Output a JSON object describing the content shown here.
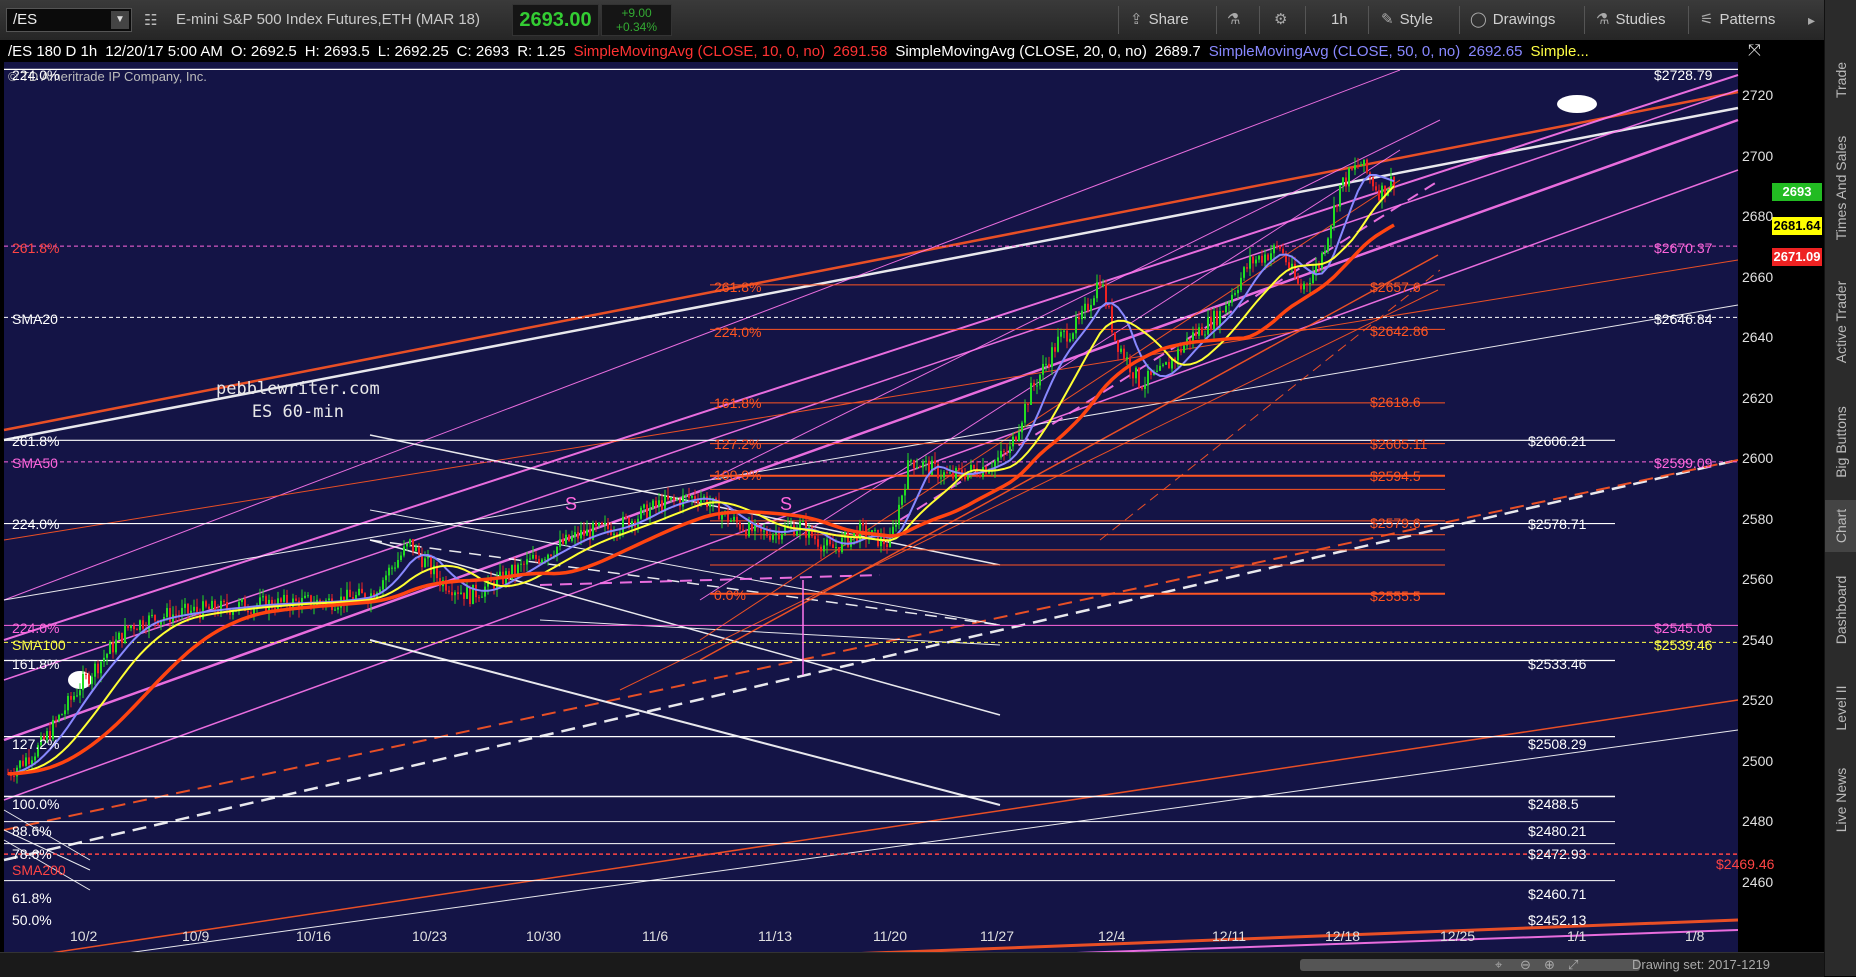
{
  "toolbar": {
    "symbol": "/ES",
    "description": "E-mini S&P 500 Index Futures,ETH (MAR 18)",
    "last_price": "2693.00",
    "change": "+9.00",
    "change_pct": "+0.34%",
    "buttons": {
      "share": "Share",
      "interval": "1h",
      "style": "Style",
      "drawings": "Drawings",
      "studies": "Studies",
      "patterns": "Patterns"
    },
    "colors": {
      "price_up": "#33cc33"
    }
  },
  "info_bar": {
    "symbol_period": "/ES 180 D 1h",
    "date": "12/20/17 5:00 AM",
    "open": "O: 2692.5",
    "high": "H: 2693.5",
    "low": "L: 2692.25",
    "close": "C: 2693",
    "range": "R: 1.25",
    "sma10_label": "SimpleMovingAvg (CLOSE, 10, 0, no)",
    "sma10_value": "2691.58",
    "sma20_label": "SimpleMovingAvg (CLOSE, 20, 0, no)",
    "sma20_value": "2689.7",
    "sma50_label": "SimpleMovingAvg (CLOSE, 50, 0, no)",
    "sma50_value": "2692.65",
    "more": "Simple..."
  },
  "copyright": "© TD Ameritrade IP Company, Inc.",
  "watermark": {
    "line1": "pebblewriter.com",
    "line2": "ES 60-min"
  },
  "left_levels": [
    {
      "text": "224.0%",
      "color": "#ffffff"
    },
    {
      "text": "261.8%",
      "color": "#ff4444"
    },
    {
      "text": "SMA20",
      "color": "#ffffff"
    },
    {
      "text": "261.8%",
      "color": "#ffffff"
    },
    {
      "text": "SMA50",
      "color": "#ff66dd"
    },
    {
      "text": "224.0%",
      "color": "#ffffff"
    },
    {
      "text": "224.0%",
      "color": "#ff66dd"
    },
    {
      "text": "SMA100",
      "color": "#ffff44"
    },
    {
      "text": "161.8%",
      "color": "#ffffff"
    },
    {
      "text": "127.2%",
      "color": "#ffffff"
    },
    {
      "text": "100.0%",
      "color": "#ffffff"
    },
    {
      "text": "88.6%",
      "color": "#ffffff"
    },
    {
      "text": "78.6%",
      "color": "#ffffff"
    },
    {
      "text": "SMA200",
      "color": "#ff4444"
    },
    {
      "text": "61.8%",
      "color": "#ffffff"
    },
    {
      "text": "50.0%",
      "color": "#ffffff"
    }
  ],
  "fib_inner": [
    {
      "text": "261.8%"
    },
    {
      "text": "224.0%"
    },
    {
      "text": "161.8%"
    },
    {
      "text": "127.2%"
    },
    {
      "text": "100.0%"
    },
    {
      "text": "0.0%"
    }
  ],
  "fib_values": [
    "$2657.6",
    "$2642.86",
    "$2618.6",
    "$2605.11",
    "$2594.5",
    "$2579.6",
    "$2555.5"
  ],
  "right_levels": [
    {
      "text": "$2728.79",
      "color": "#ffffff"
    },
    {
      "text": "$2670.37",
      "color": "#ff66dd"
    },
    {
      "text": "$2646.84",
      "color": "#ffffff"
    },
    {
      "text": "$2606.21",
      "color": "#ffffff"
    },
    {
      "text": "$2599.09",
      "color": "#ff66dd"
    },
    {
      "text": "$2578.71",
      "color": "#ffffff"
    },
    {
      "text": "$2545.06",
      "color": "#ff66dd"
    },
    {
      "text": "$2539.46",
      "color": "#ffff44"
    },
    {
      "text": "$2533.46",
      "color": "#ffffff"
    },
    {
      "text": "$2508.29",
      "color": "#ffffff"
    },
    {
      "text": "$2488.5",
      "color": "#ffffff"
    },
    {
      "text": "$2480.21",
      "color": "#ffffff"
    },
    {
      "text": "$2472.93",
      "color": "#ffffff"
    },
    {
      "text": "$2469.46",
      "color": "#ff4444"
    },
    {
      "text": "$2460.71",
      "color": "#ffffff"
    },
    {
      "text": "$2452.13",
      "color": "#ffffff"
    }
  ],
  "price_tags": [
    {
      "text": "2693",
      "bg": "#22bb22",
      "fg": "#ffffff"
    },
    {
      "text": "2681.64",
      "bg": "#ffff00",
      "fg": "#000000"
    },
    {
      "text": "2671.09",
      "bg": "#ee2222",
      "fg": "#ffffff"
    }
  ],
  "markers": [
    "S",
    "S"
  ],
  "y_axis": [
    "2720",
    "2700",
    "2680",
    "2660",
    "2640",
    "2620",
    "2600",
    "2580",
    "2560",
    "2540",
    "2520",
    "2500",
    "2480",
    "2460"
  ],
  "x_axis": [
    "10/2",
    "10/9",
    "10/16",
    "10/23",
    "10/30",
    "11/6",
    "11/13",
    "11/20",
    "11/27",
    "12/4",
    "12/11",
    "12/18",
    "12/25",
    "1/1",
    "1/8"
  ],
  "side_tabs": [
    "Trade",
    "Times And Sales",
    "Active Trader",
    "Big Buttons",
    "Chart",
    "Dashboard",
    "Level II",
    "Live News"
  ],
  "drawing_set": "Drawing set: 2017-1219",
  "icons": [
    "chevron-down-icon",
    "sliders-icon",
    "share-icon",
    "flask-icon",
    "gear-icon",
    "style-icon",
    "drawings-icon",
    "studies-icon",
    "patterns-icon",
    "collapse-icon",
    "crosshair-icon",
    "zoom-in-icon",
    "zoom-out-icon",
    "expand-icon"
  ]
}
